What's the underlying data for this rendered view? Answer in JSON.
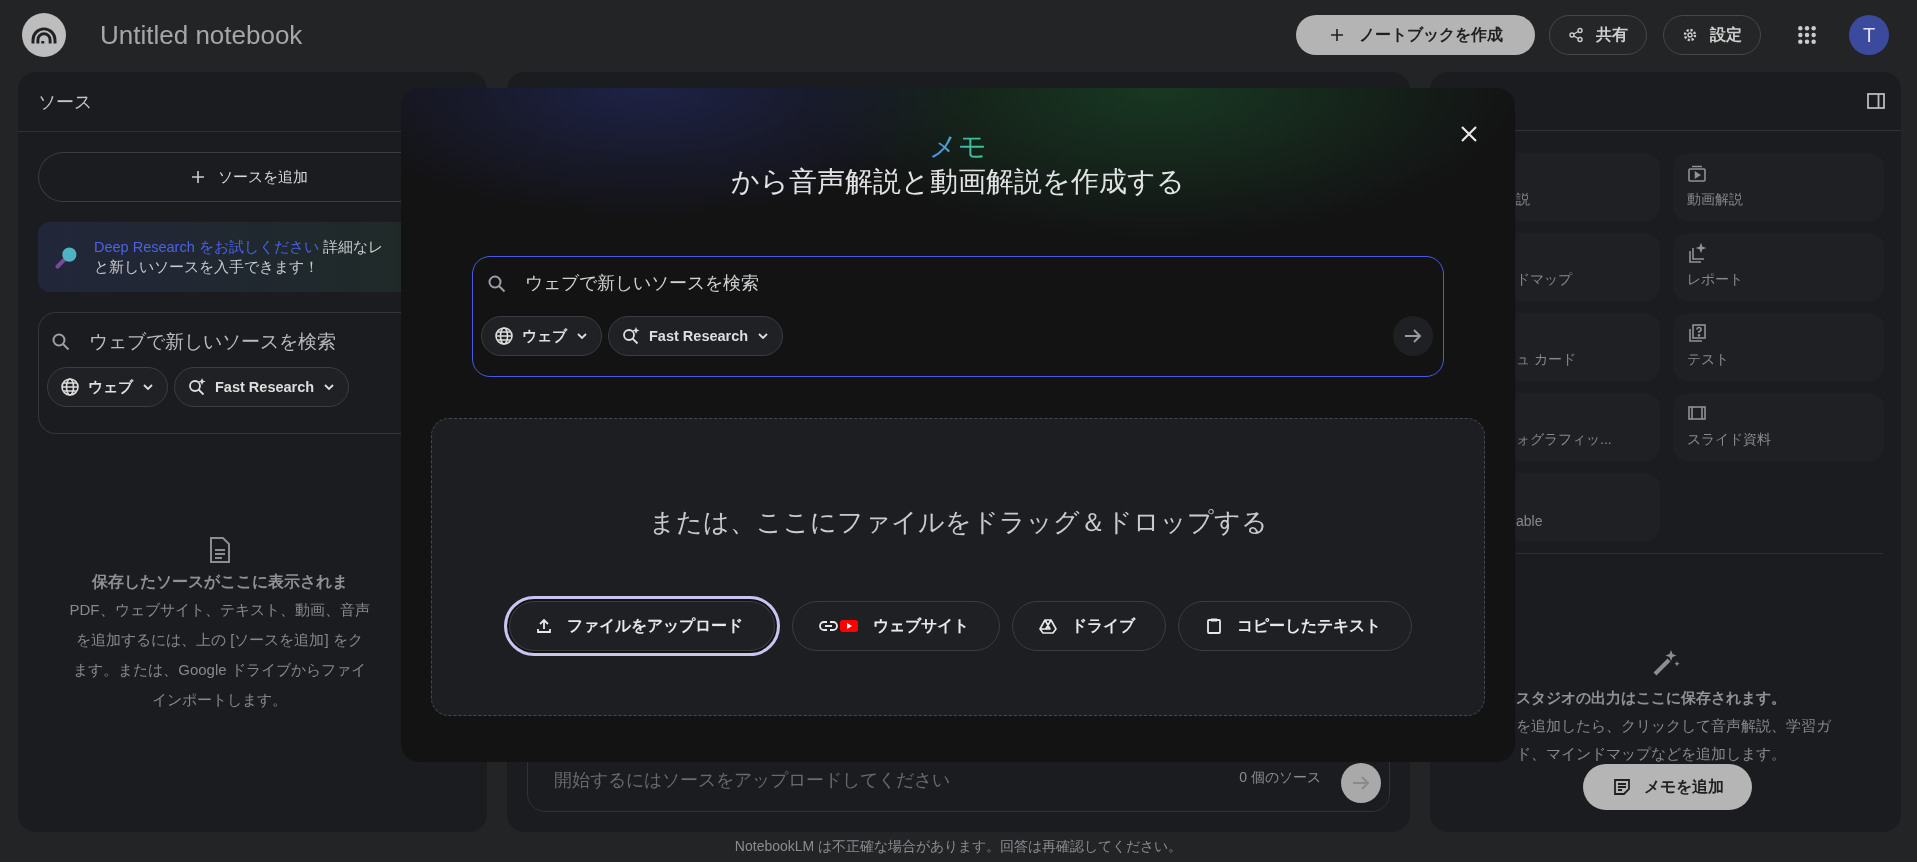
{
  "app_bar": {
    "title": "Untitled notebook",
    "create_button": "ノートブックを作成",
    "share_button": "共有",
    "settings_button": "設定",
    "avatar": "T"
  },
  "sources_panel": {
    "title": "ソース",
    "add_button": "ソースを追加",
    "promo": {
      "link": "Deep Research をお試しください",
      "text_1": "詳細なレ",
      "text_2": "と新しいソースを入手できます！"
    },
    "search": {
      "placeholder": "ウェブで新しいソースを検索",
      "chips": [
        "ウェブ",
        "Fast Research"
      ]
    },
    "empty_state": {
      "title": "保存したソースがここに表示されま",
      "lines": [
        "PDF、ウェブサイト、テキスト、動画、音声",
        "を追加するには、上の [ソースを追加] をク",
        "ます。または、Google ドライブからファイ",
        "インポートします。"
      ]
    }
  },
  "chat_panel": {
    "input_placeholder": "開始するにはソースをアップロードしてください",
    "source_count": "0 個のソース",
    "footer": "NotebookLM は不正確な場合があります。回答は再確認してください。"
  },
  "studio_panel": {
    "tiles": [
      {
        "label": "説",
        "covered": true
      },
      {
        "label": "動画解説",
        "covered": false
      },
      {
        "label": "ドマップ",
        "covered": true
      },
      {
        "label": "レポート",
        "covered": false
      },
      {
        "label": "ュ カード",
        "covered": true
      },
      {
        "label": "テスト",
        "covered": false
      },
      {
        "label": "ォグラフィッ...",
        "covered": true
      },
      {
        "label": "スライド資料",
        "covered": false
      },
      {
        "label": "able",
        "covered": true
      }
    ],
    "empty_state": {
      "lines": [
        "スタジオの出力はここに保存されます。",
        "を追加したら、クリックして音声解説、学習ガ",
        "ド、マインドマップなどを追加します。"
      ]
    },
    "note_button": "メモを追加"
  },
  "modal": {
    "title_highlight": "メモ",
    "title": "から音声解説と動画解説を作成する",
    "search": {
      "placeholder": "ウェブで新しいソースを検索",
      "chips": [
        "ウェブ",
        "Fast Research"
      ]
    },
    "drop_text": "または、ここにファイルをドラッグ＆ドロップする",
    "buttons": [
      {
        "label": "ファイルをアップロード",
        "focused": true
      },
      {
        "label": "ウェブサイト",
        "focused": false
      },
      {
        "label": "ドライブ",
        "focused": false
      },
      {
        "label": "コピーしたテキスト",
        "focused": false
      }
    ]
  }
}
